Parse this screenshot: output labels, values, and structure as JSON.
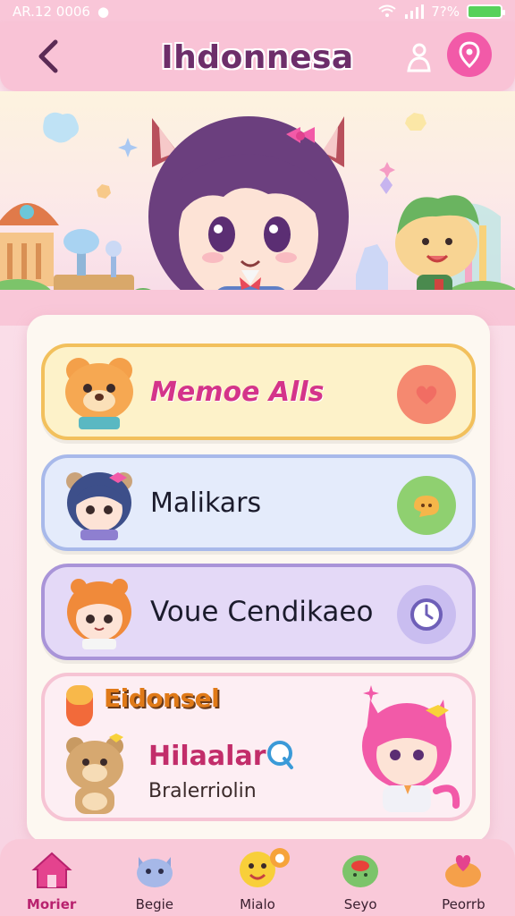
{
  "status_bar": {
    "time": "AR.12 0006",
    "battery_percent": "7?%"
  },
  "header": {
    "title": "Ihdonnesa"
  },
  "menu": [
    {
      "label": "Memoe Alls",
      "accent": "#f2c05c"
    },
    {
      "label": "Malikars",
      "accent": "#a8b9ea"
    },
    {
      "label": "Voue Cendikaeo",
      "accent": "#a994d8"
    }
  ],
  "promo": {
    "tag": "Eidonsel",
    "title": "Hilaalar",
    "subtitle": "Bralerriolin"
  },
  "nav": [
    {
      "label": "Morier"
    },
    {
      "label": "Begie"
    },
    {
      "label": "Mialo"
    },
    {
      "label": "Seyo"
    },
    {
      "label": "Peorrb"
    }
  ],
  "colors": {
    "accent_pink": "#f25aa8",
    "header_bg": "#f9c3d6",
    "panel_bg": "#fdf8f1"
  }
}
